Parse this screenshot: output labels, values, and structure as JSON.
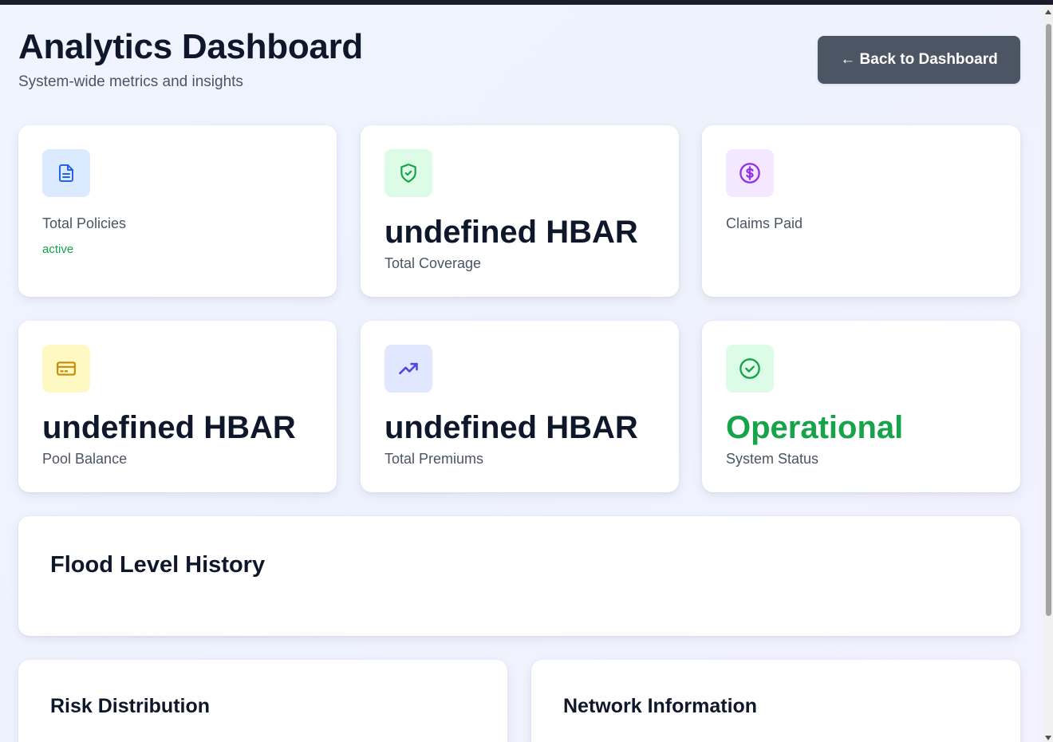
{
  "header": {
    "title": "Analytics Dashboard",
    "subtitle": "System-wide metrics and insights",
    "back_button": "← Back to Dashboard"
  },
  "stats": [
    {
      "icon": "document-icon",
      "icon_color": "#2563eb",
      "tile_color": "#dbeafe",
      "value": "",
      "label": "Total Policies",
      "note": "active"
    },
    {
      "icon": "shield-check-icon",
      "icon_color": "#16a34a",
      "tile_color": "#dcfce7",
      "value": "undefined HBAR",
      "label": "Total Coverage"
    },
    {
      "icon": "dollar-circle-icon",
      "icon_color": "#9333ea",
      "tile_color": "#f3e8ff",
      "value": "",
      "label": "Claims Paid"
    },
    {
      "icon": "credit-card-icon",
      "icon_color": "#ca8a04",
      "tile_color": "#fef9c3",
      "value": "undefined HBAR",
      "label": "Pool Balance"
    },
    {
      "icon": "trending-up-icon",
      "icon_color": "#4f46e5",
      "tile_color": "#e0e7ff",
      "value": "undefined HBAR",
      "label": "Total Premiums"
    },
    {
      "icon": "check-circle-icon",
      "icon_color": "#16a34a",
      "tile_color": "#dcfce7",
      "value": "Operational",
      "value_color": "#16a34a",
      "label": "System Status"
    }
  ],
  "sections": {
    "flood_history": "Flood Level History",
    "risk_distribution": "Risk Distribution",
    "network_information": "Network Information"
  }
}
